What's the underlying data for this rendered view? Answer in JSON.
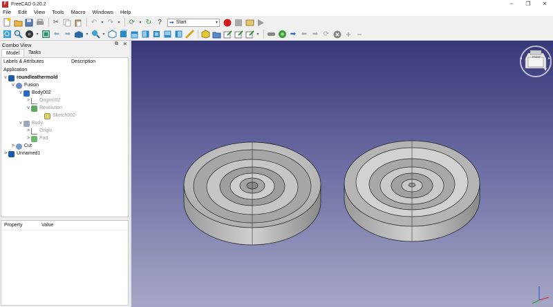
{
  "window": {
    "title": "FreeCAD 0.20.2",
    "app_icon_letter": "F"
  },
  "menu": [
    "File",
    "Edit",
    "View",
    "Tools",
    "Macro",
    "Windows",
    "Help"
  ],
  "workbench": {
    "selected": "Start"
  },
  "combo_view": {
    "title": "Combo View",
    "tabs": [
      {
        "label": "Model",
        "active": true
      },
      {
        "label": "Tasks",
        "active": false
      }
    ],
    "tree": {
      "col_labels": "Labels & Attributes",
      "col_description": "Description",
      "root": "Application",
      "items": [
        {
          "label": "roundleathermold",
          "depth": 0,
          "expand": "v",
          "icon": "document-icon",
          "bold": true,
          "dim": false
        },
        {
          "label": "Fusion",
          "depth": 1,
          "expand": "v",
          "icon": "fusion-icon",
          "bold": false,
          "dim": false
        },
        {
          "label": "Body002",
          "depth": 2,
          "expand": "v",
          "icon": "body-icon",
          "bold": false,
          "dim": false
        },
        {
          "label": "Origin002",
          "depth": 3,
          "expand": ">",
          "icon": "origin-icon",
          "bold": false,
          "dim": true
        },
        {
          "label": "Revolution",
          "depth": 3,
          "expand": "v",
          "icon": "revolution-icon",
          "bold": false,
          "dim": true
        },
        {
          "label": "Sketch002",
          "depth": 4,
          "expand": "",
          "icon": "sketch-icon",
          "bold": false,
          "dim": true
        },
        {
          "label": "Body",
          "depth": 2,
          "expand": "v",
          "icon": "body-icon",
          "bold": false,
          "dim": true
        },
        {
          "label": "Origin",
          "depth": 3,
          "expand": ">",
          "icon": "origin-icon",
          "bold": false,
          "dim": true
        },
        {
          "label": "Pad",
          "depth": 3,
          "expand": ">",
          "icon": "pad-icon",
          "bold": false,
          "dim": true
        },
        {
          "label": "Cut",
          "depth": 1,
          "expand": ">",
          "icon": "cut-icon",
          "bold": false,
          "dim": false
        },
        {
          "label": "Unnamed1",
          "depth": 0,
          "expand": ">",
          "icon": "document-icon",
          "bold": false,
          "dim": false
        }
      ]
    },
    "properties": {
      "col_property": "Property",
      "col_value": "Value"
    }
  },
  "navcube": {
    "face_label": "FRONT"
  },
  "colors": {
    "viewport_top": "#363878",
    "viewport_bottom": "#a6a7c6",
    "model_gray": "#b4b4b4",
    "record_red": "#d01818"
  }
}
